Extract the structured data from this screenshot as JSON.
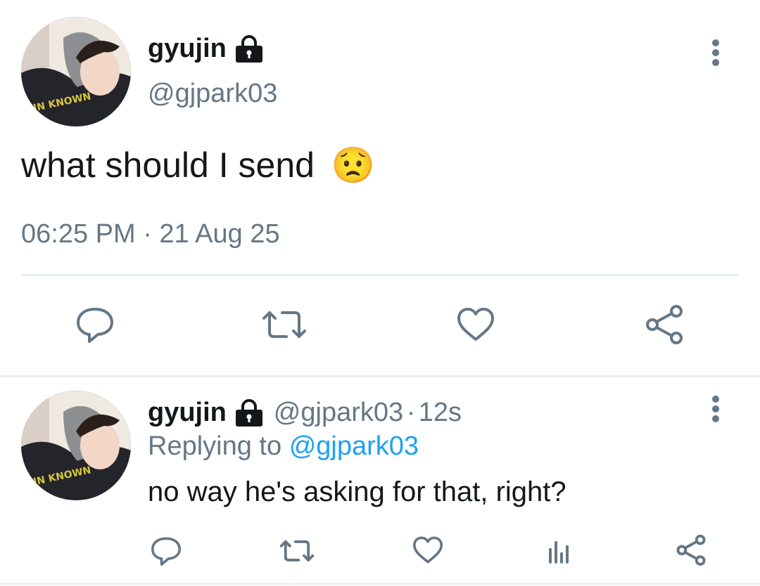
{
  "main_tweet": {
    "author_name": "gyujin",
    "author_handle": "@gjpark03",
    "text": "what should I send",
    "emoji": "😟",
    "timestamp": "06:25 PM · 21 Aug 25",
    "avatar_jacket_text": "UN KNOWN",
    "actions": {
      "reply_icon": "speech-bubble-icon",
      "retweet_icon": "retweet-icon",
      "like_icon": "heart-icon",
      "share_icon": "share-icon"
    }
  },
  "reply_tweet": {
    "author_name": "gyujin",
    "author_handle": "@gjpark03",
    "separator": "·",
    "time_ago": "12s",
    "replying_prefix": "Replying to",
    "replying_to": "@gjpark03",
    "text": "no way he's asking for that, right?",
    "avatar_jacket_text": "UN KNOWN",
    "actions": {
      "reply_icon": "speech-bubble-icon",
      "retweet_icon": "retweet-icon",
      "like_icon": "heart-icon",
      "analytics_icon": "analytics-icon",
      "share_icon": "share-icon"
    }
  },
  "colors": {
    "primary_text": "#14171a",
    "secondary_text": "#657786",
    "link": "#1da1f2",
    "divider": "#e6ecf0"
  }
}
